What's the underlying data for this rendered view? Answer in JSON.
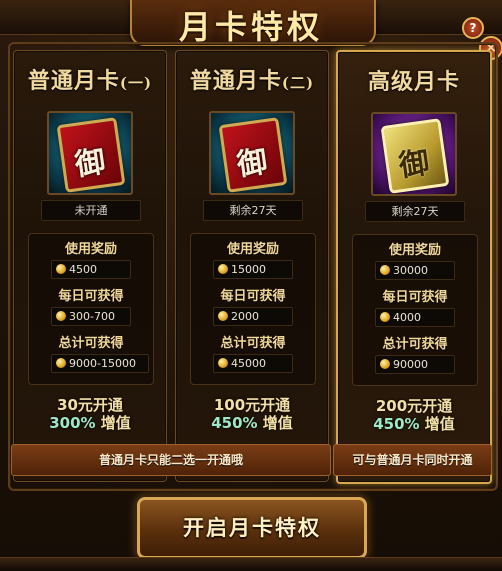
{
  "title": "月卡特权",
  "help_label": "?",
  "close_label": "×",
  "cards": [
    {
      "name": "普通月卡",
      "number": "(一)",
      "glyph": "御",
      "status": "未开通",
      "reward_label": "使用奖励",
      "reward_value": "4500",
      "daily_label": "每日可获得",
      "daily_value": "300-700",
      "total_label": "总计可获得",
      "total_value": "9000-15000",
      "price": "30元开通",
      "bonus_pct": "300%",
      "bonus_word": "增值"
    },
    {
      "name": "普通月卡",
      "number": "(二)",
      "glyph": "御",
      "status": "剩余27天",
      "reward_label": "使用奖励",
      "reward_value": "15000",
      "daily_label": "每日可获得",
      "daily_value": "2000",
      "total_label": "总计可获得",
      "total_value": "45000",
      "price": "100元开通",
      "bonus_pct": "450%",
      "bonus_word": "增值"
    },
    {
      "name": "高级月卡",
      "number": "",
      "glyph": "御",
      "status": "剩余27天",
      "reward_label": "使用奖励",
      "reward_value": "30000",
      "daily_label": "每日可获得",
      "daily_value": "4000",
      "total_label": "总计可获得",
      "total_value": "90000",
      "price": "200元开通",
      "bonus_pct": "450%",
      "bonus_word": "增值"
    }
  ],
  "notes": {
    "normal": "普通月卡只能二选一开通哦",
    "premium": "可与普通月卡同时开通"
  },
  "open_button": "开启月卡特权",
  "colors": {
    "gold_text": "#f1d79a",
    "bonus_green": "#9ee7c8",
    "premium_border": "#d7a84b"
  }
}
